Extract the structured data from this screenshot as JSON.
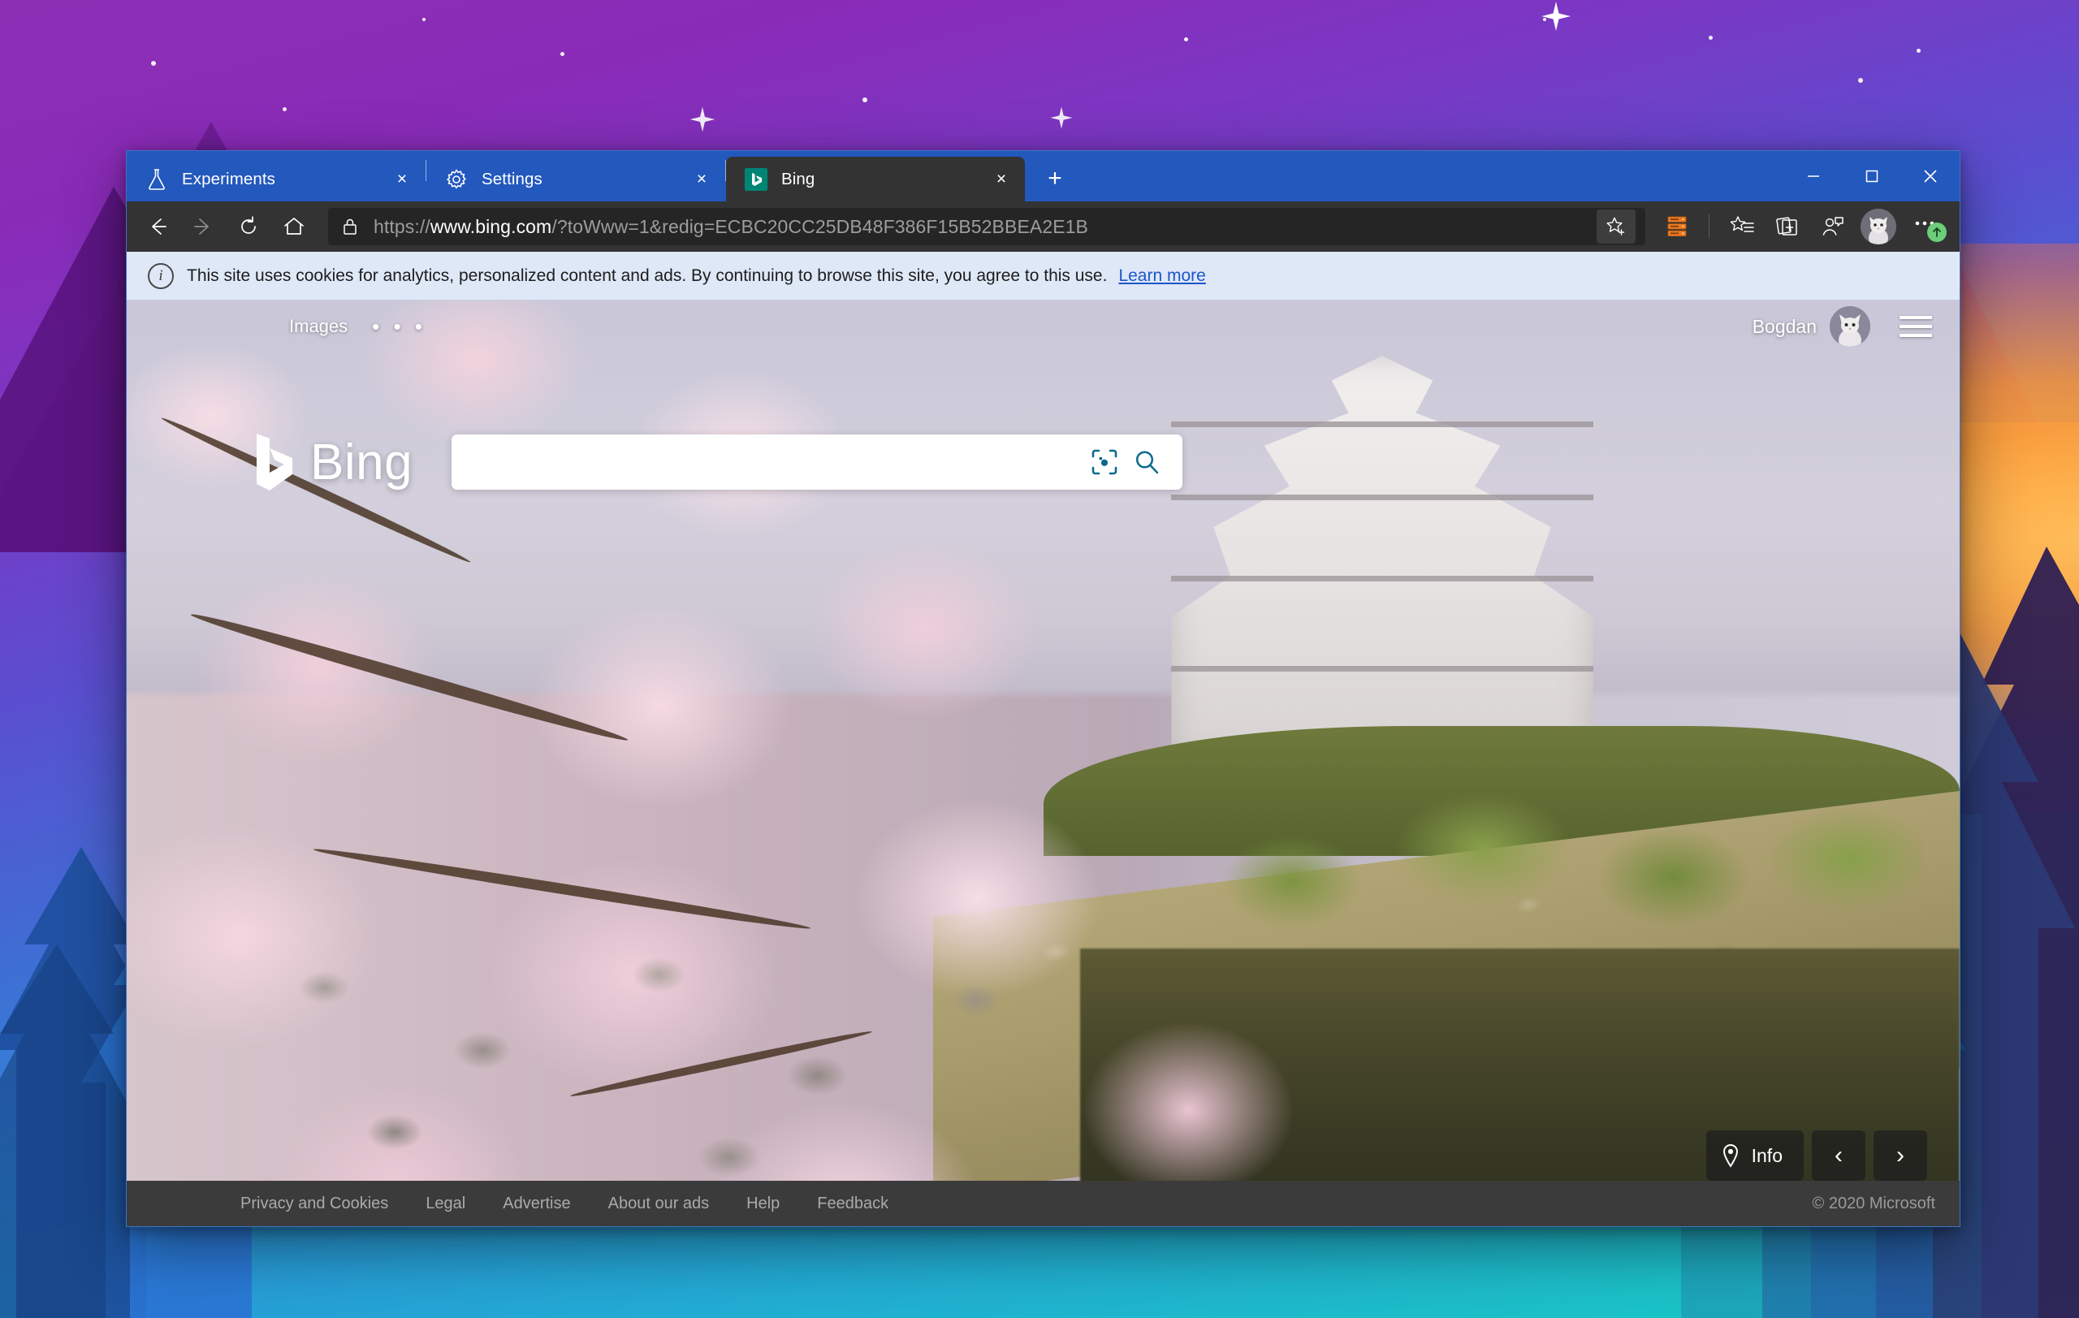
{
  "window": {
    "controls": {
      "minimize": "minimize-button",
      "maximize": "maximize-button",
      "close": "close-button"
    }
  },
  "tabs": [
    {
      "title": "Experiments",
      "icon": "flask-icon",
      "active": false,
      "close": "×"
    },
    {
      "title": "Settings",
      "icon": "gear-icon",
      "active": false,
      "close": "×"
    },
    {
      "title": "Bing",
      "icon": "bing-favicon",
      "active": true,
      "close": "×"
    }
  ],
  "newtab_label": "+",
  "toolbar": {
    "back": "back-arrow",
    "forward": "forward-arrow",
    "refresh": "refresh-icon",
    "home": "home-icon",
    "url_scheme": "https://",
    "url_host": "www.bing.com",
    "url_path": "/?toWww=1&redig=ECBC20CC25DB48F386F15B52BBEA2E1B",
    "url_full": "https://www.bing.com/?toWww=1&redig=ECBC20CC25DB48F386F15B52BBEA2E1B",
    "add_favorite": "add-favorite-star-icon",
    "extension": "extension-icon",
    "favorites": "favorites-icon",
    "collections": "collections-icon",
    "feedback": "feedback-icon",
    "profile": "profile-avatar",
    "more": "more-settings-icon",
    "update_badge": "↑"
  },
  "cookie_notice": {
    "icon": "info-icon",
    "text": "This site uses cookies for analytics, personalized content and ads. By continuing to browse this site, you agree to this use.",
    "link": "Learn more"
  },
  "bing": {
    "nav": {
      "images": "Images",
      "overflow": "• • •"
    },
    "user": {
      "name": "Bogdan",
      "avatar": "cat-avatar",
      "menu": "hamburger-menu-icon"
    },
    "logo_text": "Bing",
    "search": {
      "value": "",
      "placeholder": "",
      "visual_search_icon": "visual-search-icon",
      "search_icon": "search-icon"
    },
    "image_controls": {
      "info_label": "Info",
      "info_icon": "location-pin-icon",
      "prev": "‹",
      "next": "›"
    },
    "footer": {
      "links": [
        "Privacy and Cookies",
        "Legal",
        "Advertise",
        "About our ads",
        "Help",
        "Feedback"
      ],
      "copyright": "© 2020 Microsoft"
    }
  },
  "colors": {
    "tabstrip": "#2358bd",
    "toolbar": "#333333",
    "omnibox": "#252525",
    "cookie_bg": "#dfe8f7",
    "cookie_link": "#1a56c9",
    "bing_accent": "#0d6a8c",
    "update_badge": "#6ccd7a",
    "extension": "#ec7a22"
  }
}
